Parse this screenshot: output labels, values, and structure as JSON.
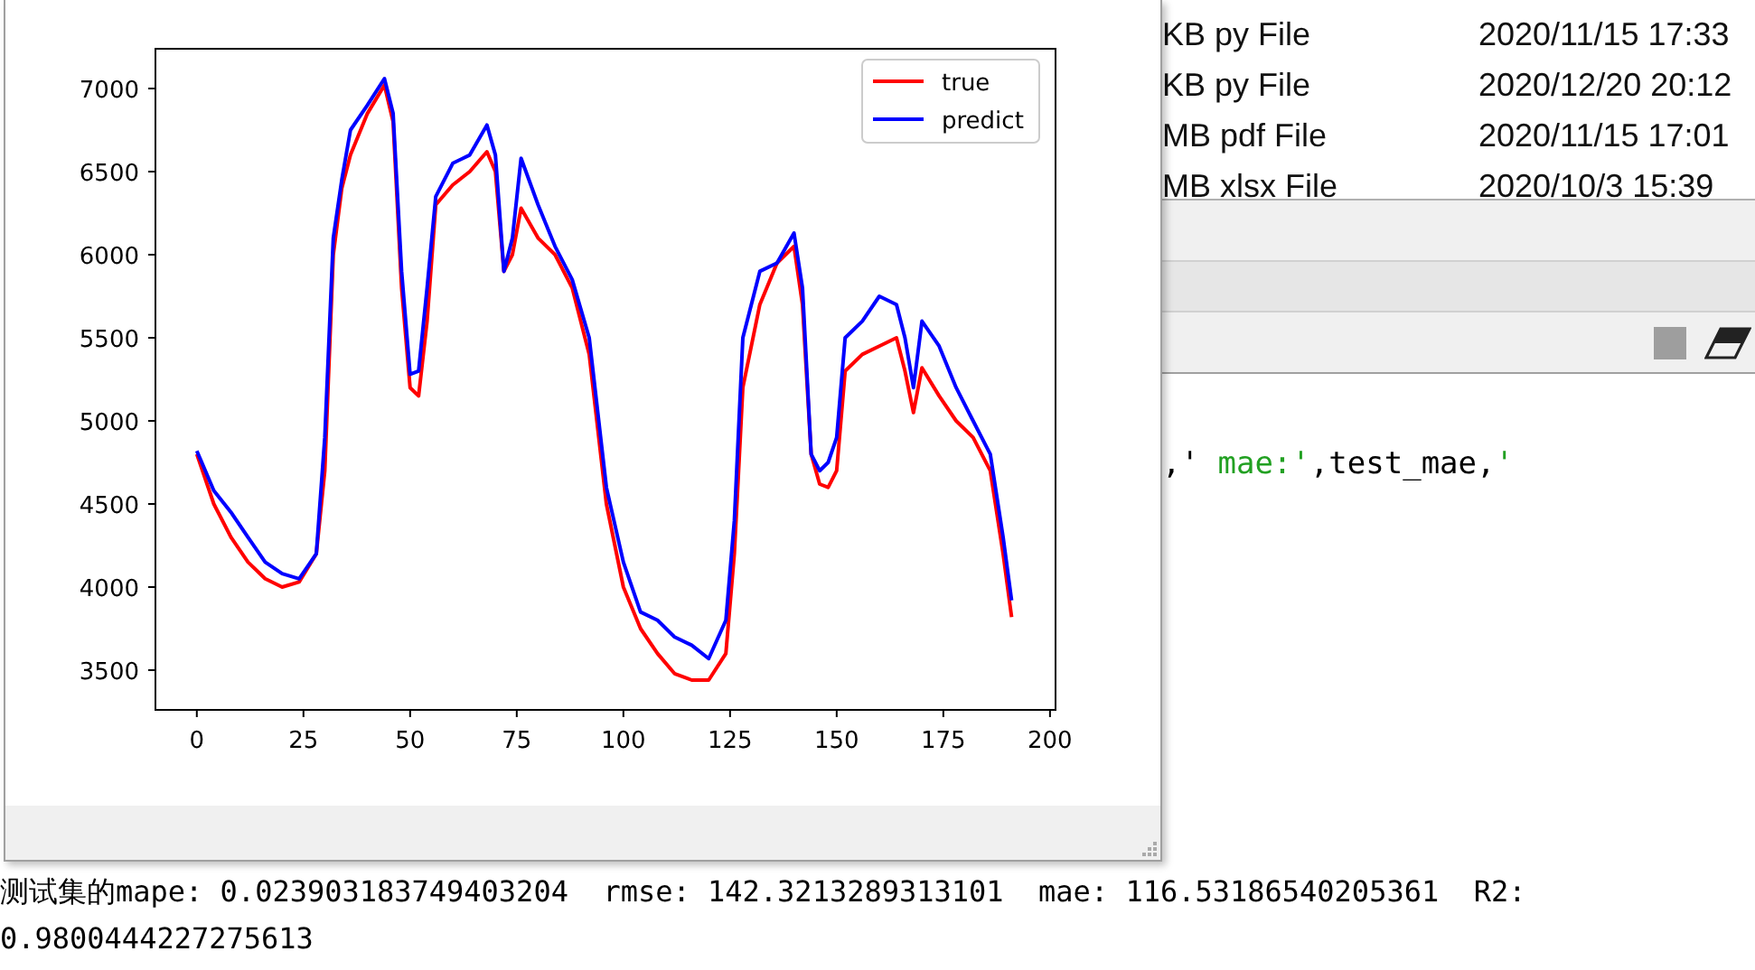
{
  "files": [
    {
      "size_type": "KB py File",
      "modified": "2020/11/15 17:33"
    },
    {
      "size_type": "KB py File",
      "modified": "2020/12/20 20:12"
    },
    {
      "size_type": "MB pdf File",
      "modified": "2020/11/15 17:01"
    },
    {
      "size_type": "MB xlsx File",
      "modified": "2020/10/3 15:39"
    }
  ],
  "code_line": [
    {
      "kind": "code",
      "text": ",'"
    },
    {
      "kind": "string",
      "text": " mae:'"
    },
    {
      "kind": "code",
      "text": ",test_mae,"
    },
    {
      "kind": "string",
      "text": "'"
    }
  ],
  "figure": {
    "chart_data": {
      "type": "line",
      "x": [
        0,
        4,
        8,
        12,
        16,
        20,
        24,
        28,
        30,
        32,
        34,
        36,
        40,
        44,
        46,
        48,
        50,
        52,
        54,
        56,
        60,
        64,
        68,
        70,
        72,
        74,
        76,
        80,
        84,
        88,
        92,
        96,
        100,
        104,
        108,
        112,
        116,
        120,
        124,
        126,
        128,
        132,
        136,
        140,
        142,
        144,
        146,
        148,
        150,
        152,
        156,
        160,
        164,
        166,
        168,
        170,
        174,
        178,
        182,
        186,
        189,
        191
      ],
      "series": [
        {
          "name": "true",
          "color": "#ff0000",
          "values": [
            4800,
            4500,
            4300,
            4150,
            4050,
            4000,
            4030,
            4200,
            4700,
            6000,
            6400,
            6600,
            6850,
            7020,
            6800,
            5800,
            5200,
            5150,
            5600,
            6300,
            6420,
            6500,
            6620,
            6500,
            5900,
            6000,
            6280,
            6100,
            6000,
            5800,
            5400,
            4500,
            4000,
            3750,
            3600,
            3480,
            3440,
            3440,
            3600,
            4200,
            5200,
            5700,
            5950,
            6050,
            5700,
            4800,
            4620,
            4600,
            4700,
            5300,
            5400,
            5450,
            5500,
            5300,
            5050,
            5320,
            5150,
            5000,
            4900,
            4700,
            4200,
            3820
          ]
        },
        {
          "name": "predict",
          "color": "#0000ff",
          "values": [
            4820,
            4580,
            4450,
            4300,
            4150,
            4080,
            4050,
            4200,
            4900,
            6100,
            6450,
            6750,
            6900,
            7060,
            6850,
            5900,
            5280,
            5300,
            5800,
            6350,
            6550,
            6600,
            6780,
            6600,
            5900,
            6100,
            6580,
            6300,
            6050,
            5850,
            5500,
            4600,
            4150,
            3850,
            3800,
            3700,
            3650,
            3570,
            3800,
            4400,
            5500,
            5900,
            5950,
            6130,
            5800,
            4800,
            4700,
            4750,
            4900,
            5500,
            5600,
            5750,
            5700,
            5500,
            5200,
            5600,
            5450,
            5200,
            5000,
            4800,
            4300,
            3920
          ]
        }
      ],
      "xlim": [
        -9.7,
        201.3
      ],
      "ylim": [
        3261,
        7239
      ],
      "xticks": [
        0,
        25,
        50,
        75,
        100,
        125,
        150,
        175,
        200
      ],
      "yticks": [
        3500,
        4000,
        4500,
        5000,
        5500,
        6000,
        6500,
        7000
      ],
      "legend": true
    }
  },
  "console_output": [
    "测试集的mape: 0.023903183749403204  rmse: 142.3213289313101  mae: 116.53186540205361  R2:",
    "0.9800444227275613"
  ]
}
